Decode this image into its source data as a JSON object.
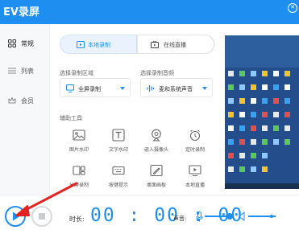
{
  "app": {
    "title": "EV录屏",
    "close_icon": "close-circle-icon"
  },
  "sidebar": {
    "items": [
      {
        "label": "常规",
        "icon": "grid-icon",
        "active": true
      },
      {
        "label": "列表",
        "icon": "list-icon",
        "active": false
      },
      {
        "label": "会员",
        "icon": "crown-icon",
        "active": false
      }
    ]
  },
  "mode_tabs": [
    {
      "label": "本地录制",
      "icon": "video-camera-icon",
      "active": true
    },
    {
      "label": "在线直播",
      "icon": "broadcast-icon",
      "active": false
    }
  ],
  "settings": {
    "area_label": "选择录制区域",
    "area_value": "全屏录制",
    "audio_label": "选择录制音频",
    "audio_value": "麦和系统声音"
  },
  "tools": {
    "heading": "辅助工具",
    "items": [
      {
        "label": "图片水印",
        "icon": "image-icon"
      },
      {
        "label": "文字水印",
        "icon": "text-icon"
      },
      {
        "label": "嵌入摄像头",
        "icon": "webcam-icon"
      },
      {
        "label": "定时录制",
        "icon": "alarm-clock-icon"
      },
      {
        "label": "分屏录制",
        "icon": "split-screen-icon"
      },
      {
        "label": "按键提示",
        "icon": "keyboard-icon"
      },
      {
        "label": "桌面画板",
        "icon": "drawing-board-icon"
      },
      {
        "label": "本地直播",
        "icon": "monitor-icon"
      }
    ]
  },
  "controls": {
    "duration_label": "时长:",
    "timer": "00:00:00",
    "volume_label": "声音:",
    "record_icon": "play-icon",
    "stop_icon": "stop-icon",
    "mic_icon": "microphone-icon",
    "speaker_icon": "speaker-icon",
    "mic_volume": 0.85,
    "speaker_volume": 0.85
  },
  "colors": {
    "accent": "#1e8ff0",
    "annotation_arrow": "#e52222",
    "preview_desktop": "#244d8c"
  }
}
